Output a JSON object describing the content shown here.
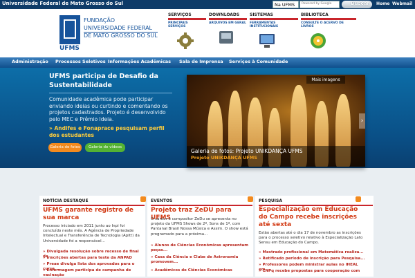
{
  "topbar": {
    "site": "Universidade Federal de Mato Grosso do Sul",
    "select_value": "Na UFMS",
    "search_brand": "Powered by Google",
    "search_button": "Buscar",
    "home": "Home",
    "webmail": "Webmail"
  },
  "header": {
    "logo_line1": "FUNDAÇÃO",
    "logo_line2": "UNIVERSIDADE FEDERAL",
    "logo_line3": "DE MATO GROSSO DO SUL",
    "logo_short": "UFMS",
    "services": [
      {
        "title": "SERVIÇOS",
        "sub": "PRINCIPAIS SERVIÇOS",
        "icon": "gear-icon"
      },
      {
        "title": "DOWNLOADS",
        "sub": "ARQUIVOS EM GERAL",
        "icon": "download-icon"
      },
      {
        "title": "SISTEMAS",
        "sub": "FERRAMENTAS INSTITUCIONAIS",
        "icon": "monitor-icon"
      },
      {
        "title": "BIBLIOTECA",
        "sub": "CONSULTE O ACERVO DE LIVROS",
        "icon": "cd-icon"
      }
    ]
  },
  "nav": [
    "Administração",
    "Processos Seletivos",
    "Informações Acadêmicas",
    "Sala de Imprensa",
    "Serviços à Comunidade"
  ],
  "hero": {
    "title": "UFMS participa de Desafio da Sustentabilidade",
    "body": "Comunidade acadêmica pode participar enviando ideias ou curtindo e comentando os projetos cadastrados. Projeto é desenvolvido pelo MEC e Prêmio Ideia.",
    "link": "» Andifes e Fonaprace pesquisam perfil dos estudantes",
    "btn_photos": "Galeria de fotos",
    "btn_videos": "Galeria de vídeos",
    "more": "Mais imagens",
    "caption": "Galeria de fotos: Projeto UNIKDANÇA UFMS",
    "caption_sub": "Projeto UNIKDANÇA UFMS"
  },
  "columns": [
    {
      "head": "NOTÍCIA DESTAQUE",
      "title": "UFMS garante registro de sua marca",
      "body": "Processo iniciado em 2011 junto ao Inpi foi concluído neste mês. A Agência de Propriedade Intelectual e Transferência de Tecnologia (Apitt) da Universidade foi a responsável...",
      "links": [
        "» Divulgada resolução sobre recesso de final de...",
        "» Inscrições abertas para teste da ANPAD",
        "» Preae divulga lista dos aprovados para o curso...",
        "» Enfermagem participa de campanha de vacinação"
      ]
    },
    {
      "head": "EVENTOS",
      "title": "Projeto traz ZeDU para UFMS",
      "body": "O cantor e compositor ZeDu se apresenta no projeto da UFMS Shows de 2ª, Sons de 1ª, com Pantanal Brasil Nossa Música e Assim. O show está programado para a próxima...",
      "links": [
        "» Alunos de Ciências Econômicas apresentam peças...",
        "» Casa da Ciência e Clube de Astronomia promovem...",
        "» Acadêmicos de Ciências Econômicas"
      ]
    },
    {
      "head": "PESQUISA",
      "title": "Especialização em Educação do Campo recebe inscrições até sexta",
      "body": "Estão abertas até o dia 17 de novembro as inscrições para o processo seletivo relativo à Especialização Lato Sensu em Educação do Campo.",
      "links": [
        "» Mestrado profissional em Matemática realiza...",
        "» Retificado período de inscrição para Pesquisa...",
        "» Professores podem ministrar aulas no IHEAL em...",
        "» CNPq recebe propostas para cooperação com"
      ]
    }
  ],
  "colors": {
    "accent": "#c9252b",
    "brand": "#16539b",
    "orange": "#f28a1e",
    "green": "#54b233"
  }
}
